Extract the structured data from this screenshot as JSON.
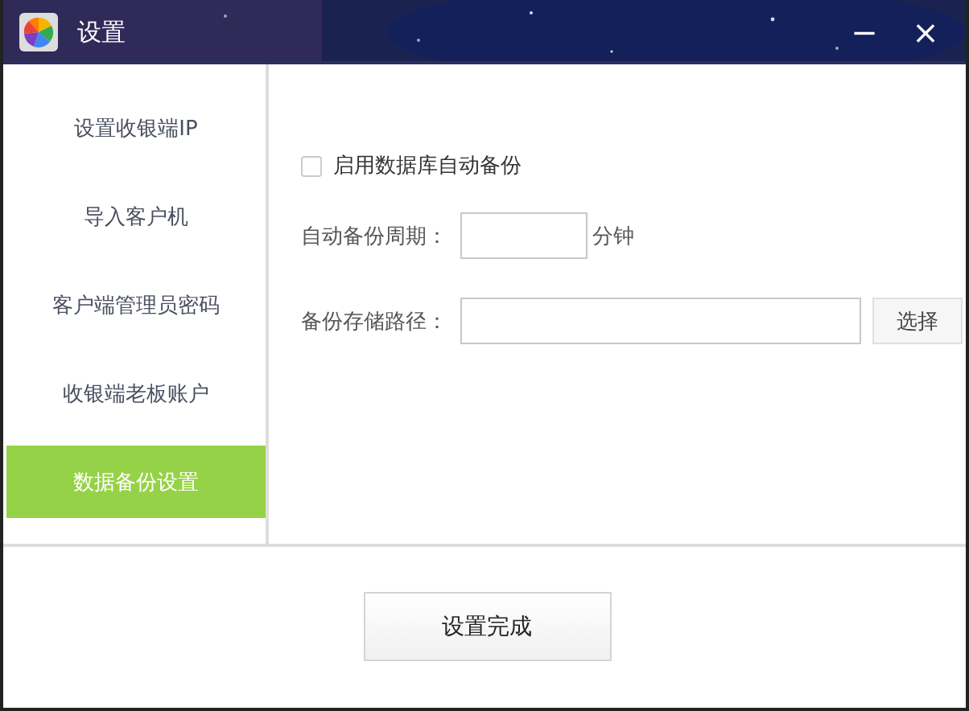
{
  "window": {
    "title": "设置",
    "controls": [
      "−",
      "×"
    ]
  },
  "sidebar": {
    "items": [
      {
        "label": "设置收银端IP",
        "selected": false
      },
      {
        "label": "导入客户机",
        "selected": false
      },
      {
        "label": "客户端管理员密码",
        "selected": false
      },
      {
        "label": "收银端老板账户",
        "selected": false
      },
      {
        "label": "数据备份设置",
        "selected": true
      }
    ]
  },
  "backup": {
    "enable": {
      "label": "启用数据库自动备份",
      "checked": false
    },
    "period": {
      "label": "自动备份周期：",
      "unit": "分钟"
    },
    "path": {
      "label": "备份存储路径：",
      "button": "选择"
    }
  },
  "footer": {
    "button": "设置完成"
  }
}
